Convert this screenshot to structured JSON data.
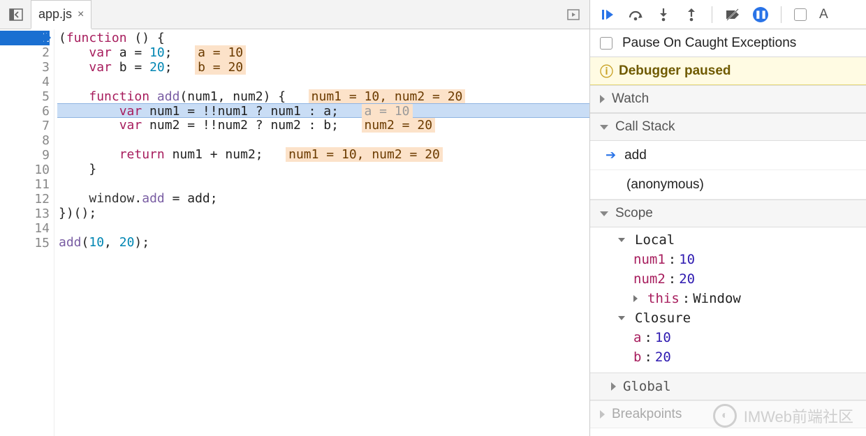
{
  "tab": {
    "filename": "app.js",
    "close_glyph": "×"
  },
  "toolbar_icons": {
    "nav_back": "⎘",
    "resume": "▶",
    "step_over": "↷",
    "step_into": "↓",
    "step_out": "↑",
    "deactivate": "⟋",
    "pause": "❚❚",
    "settings": "A"
  },
  "editor": {
    "active_line": 1,
    "current_execution_line": 6,
    "lines": [
      {
        "n": 1,
        "tokens": [
          {
            "t": "(",
            "c": ""
          },
          {
            "t": "function",
            "c": "kw"
          },
          {
            "t": " () {",
            "c": ""
          }
        ]
      },
      {
        "n": 2,
        "tokens": [
          {
            "t": "    ",
            "c": ""
          },
          {
            "t": "var",
            "c": "kw"
          },
          {
            "t": " a = ",
            "c": ""
          },
          {
            "t": "10",
            "c": "num"
          },
          {
            "t": ";   ",
            "c": ""
          }
        ],
        "hint": "a = 10"
      },
      {
        "n": 3,
        "tokens": [
          {
            "t": "    ",
            "c": ""
          },
          {
            "t": "var",
            "c": "kw"
          },
          {
            "t": " b = ",
            "c": ""
          },
          {
            "t": "20",
            "c": "num"
          },
          {
            "t": ";   ",
            "c": ""
          }
        ],
        "hint": "b = 20"
      },
      {
        "n": 4,
        "tokens": []
      },
      {
        "n": 5,
        "tokens": [
          {
            "t": "    ",
            "c": ""
          },
          {
            "t": "function",
            "c": "kw"
          },
          {
            "t": " ",
            "c": ""
          },
          {
            "t": "add",
            "c": "fn"
          },
          {
            "t": "(num1, num2) {   ",
            "c": ""
          }
        ],
        "hint": "num1 = 10, num2 = 20"
      },
      {
        "n": 6,
        "tokens": [
          {
            "t": "        ",
            "c": ""
          },
          {
            "t": "var",
            "c": "kw"
          },
          {
            "t": " num1 = !!num1 ? num1 : a;   ",
            "c": ""
          }
        ],
        "hint": "a = 10",
        "hint_gray": true
      },
      {
        "n": 7,
        "tokens": [
          {
            "t": "        ",
            "c": ""
          },
          {
            "t": "var",
            "c": "kw"
          },
          {
            "t": " num2 = !!num2 ? num2 : b;   ",
            "c": ""
          }
        ],
        "hint": "num2 = 20"
      },
      {
        "n": 8,
        "tokens": []
      },
      {
        "n": 9,
        "tokens": [
          {
            "t": "        ",
            "c": ""
          },
          {
            "t": "return",
            "c": "kw"
          },
          {
            "t": " num1 + num2;   ",
            "c": ""
          }
        ],
        "hint": "num1 = 10, num2 = 20"
      },
      {
        "n": 10,
        "tokens": [
          {
            "t": "    }",
            "c": ""
          }
        ]
      },
      {
        "n": 11,
        "tokens": []
      },
      {
        "n": 12,
        "tokens": [
          {
            "t": "    ",
            "c": ""
          },
          {
            "t": "window",
            "c": "obj"
          },
          {
            "t": ".",
            "c": ""
          },
          {
            "t": "add",
            "c": "prop"
          },
          {
            "t": " = add;",
            "c": ""
          }
        ]
      },
      {
        "n": 13,
        "tokens": [
          {
            "t": "})();",
            "c": ""
          }
        ]
      },
      {
        "n": 14,
        "tokens": []
      },
      {
        "n": 15,
        "tokens": [
          {
            "t": "add",
            "c": "fn"
          },
          {
            "t": "(",
            "c": ""
          },
          {
            "t": "10",
            "c": "num"
          },
          {
            "t": ", ",
            "c": ""
          },
          {
            "t": "20",
            "c": "num"
          },
          {
            "t": ");",
            "c": ""
          }
        ]
      }
    ]
  },
  "debugger": {
    "pause_on_caught_label": "Pause On Caught Exceptions",
    "status_text": "Debugger paused",
    "sections": {
      "watch": "Watch",
      "call_stack": "Call Stack",
      "scope": "Scope",
      "global": "Global",
      "breakpoints": "Breakpoints"
    },
    "call_stack": [
      {
        "name": "add",
        "active": true
      },
      {
        "name": "(anonymous)",
        "active": false
      }
    ],
    "scope": {
      "local_label": "Local",
      "local": [
        {
          "key": "num1",
          "val": "10"
        },
        {
          "key": "num2",
          "val": "20"
        },
        {
          "key": "this",
          "obj": "Window",
          "expandable": true
        }
      ],
      "closure_label": "Closure",
      "closure": [
        {
          "key": "a",
          "val": "10"
        },
        {
          "key": "b",
          "val": "20"
        }
      ]
    }
  },
  "watermark": "IMWeb前端社区"
}
